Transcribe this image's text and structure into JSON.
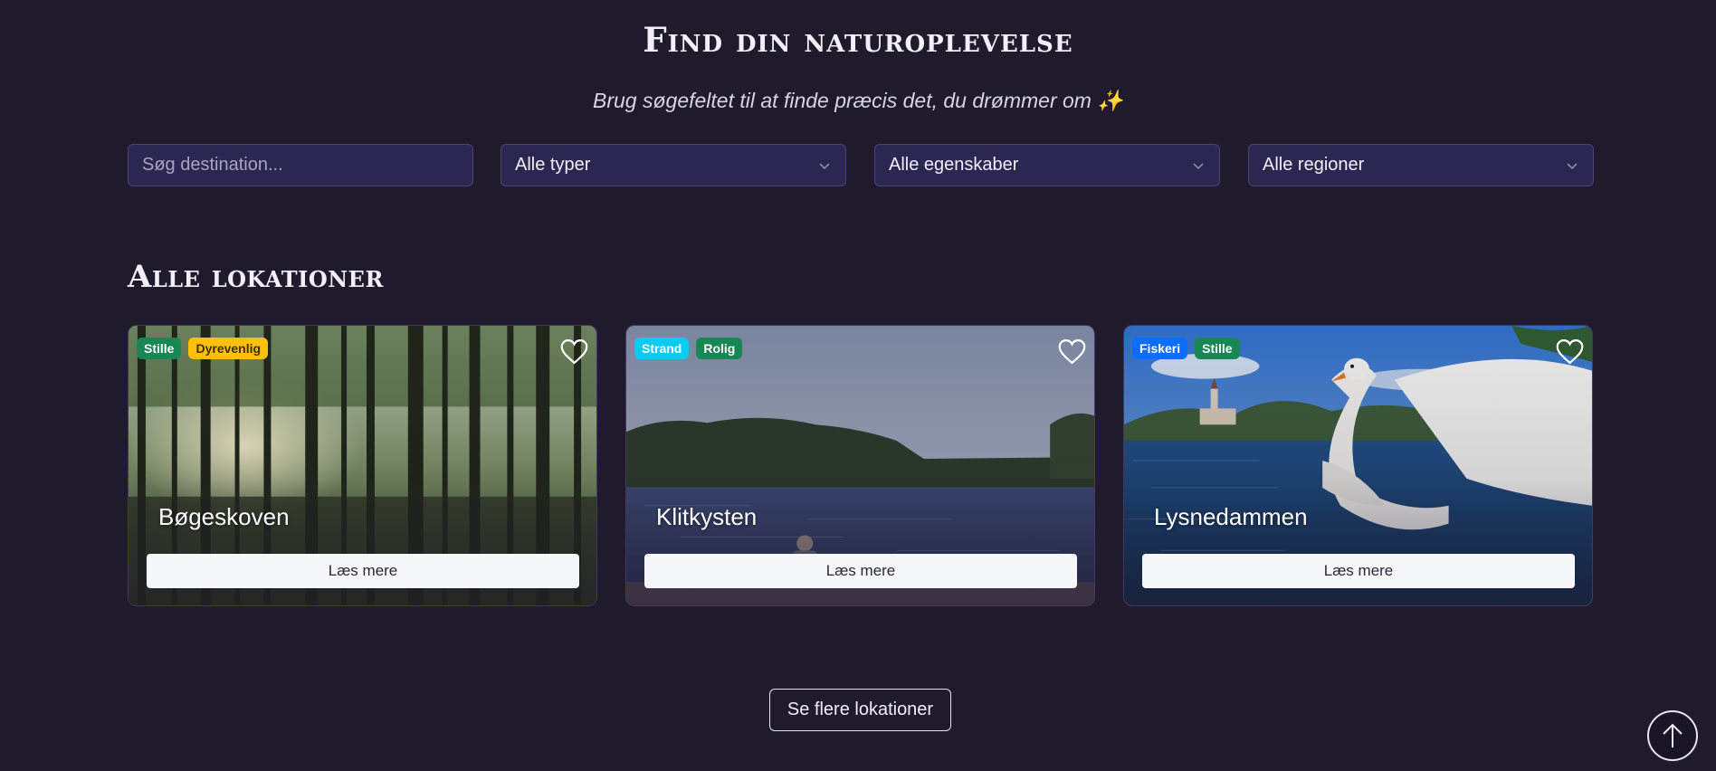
{
  "hero": {
    "title": "Find din naturoplevelse",
    "subtitle": "Brug søgefeltet til at finde præcis det, du drømmer om ✨"
  },
  "filters": {
    "search_placeholder": "Søg destination...",
    "type_select": "Alle typer",
    "features_select": "Alle egenskaber",
    "region_select": "Alle regioner"
  },
  "section": {
    "title": "Alle lokationer"
  },
  "cards": [
    {
      "name": "Bøgeskoven",
      "tags": [
        {
          "label": "Stille",
          "color": "#198754",
          "text_color": "#ffffff"
        },
        {
          "label": "Dyrevenlig",
          "color": "#ffc107",
          "text_color": "#3a2f05"
        }
      ],
      "button": "Læs mere",
      "image_icon": "forest-image"
    },
    {
      "name": "Klitkysten",
      "tags": [
        {
          "label": "Strand",
          "color": "#0dcaf0",
          "text_color": "#ffffff"
        },
        {
          "label": "Rolig",
          "color": "#198754",
          "text_color": "#ffffff"
        }
      ],
      "button": "Læs mere",
      "image_icon": "lake-image"
    },
    {
      "name": "Lysnedammen",
      "tags": [
        {
          "label": "Fiskeri",
          "color": "#0d6efd",
          "text_color": "#ffffff"
        },
        {
          "label": "Stille",
          "color": "#198754",
          "text_color": "#ffffff"
        }
      ],
      "button": "Læs mere",
      "image_icon": "swan-lake-image"
    }
  ],
  "more_button": "Se flere lokationer",
  "colors": {
    "background": "#201a2c",
    "input_bg": "#2c2750",
    "input_border": "#4a4478"
  }
}
